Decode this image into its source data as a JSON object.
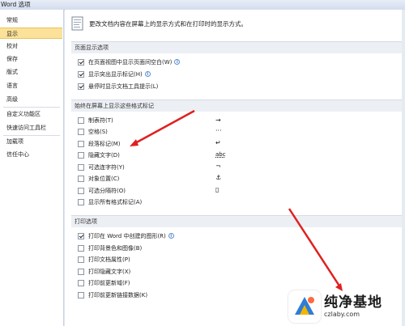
{
  "window": {
    "title": "Word 选项"
  },
  "sidebar": {
    "items": [
      {
        "label": "常规"
      },
      {
        "label": "显示",
        "active": true
      },
      {
        "label": "校对"
      },
      {
        "label": "保存"
      },
      {
        "label": "版式"
      },
      {
        "label": "语言"
      },
      {
        "label": "高级"
      },
      {
        "label": "自定义功能区"
      },
      {
        "label": "快速访问工具栏"
      },
      {
        "label": "加载项"
      },
      {
        "label": "信任中心"
      }
    ]
  },
  "header": {
    "text": "更改文档内容在屏幕上的显示方式和在打印时的显示方式。"
  },
  "page_display": {
    "title": "页面显示选项",
    "options": [
      {
        "label": "在页面视图中显示页面间空白(W)",
        "checked": true,
        "info": true
      },
      {
        "label": "显示突出显示标记(H)",
        "checked": true,
        "info": true
      },
      {
        "label": "悬停时显示文档工具提示(L)",
        "checked": true,
        "info": false
      }
    ]
  },
  "formatting_marks": {
    "title": "始终在屏幕上显示这些格式标记",
    "options": [
      {
        "label": "制表符(T)",
        "checked": false,
        "symbol": "→"
      },
      {
        "label": "空格(S)",
        "checked": false,
        "symbol": "···"
      },
      {
        "label": "段落标记(M)",
        "checked": false,
        "symbol": "↵"
      },
      {
        "label": "隐藏文字(D)",
        "checked": false,
        "symbol": "abc"
      },
      {
        "label": "可选连字符(Y)",
        "checked": false,
        "symbol": "¬"
      },
      {
        "label": "对象位置(C)",
        "checked": false,
        "symbol": "⚓"
      },
      {
        "label": "可选分隔符(O)",
        "checked": false,
        "symbol": "▯"
      },
      {
        "label": "显示所有格式标记(A)",
        "checked": false,
        "symbol": ""
      }
    ]
  },
  "print_options": {
    "title": "打印选项",
    "options": [
      {
        "label": "打印在 Word 中创建的图形(R)",
        "checked": true,
        "info": true
      },
      {
        "label": "打印背景色和图像(B)",
        "checked": false
      },
      {
        "label": "打印文档属性(P)",
        "checked": false
      },
      {
        "label": "打印隐藏文字(X)",
        "checked": false
      },
      {
        "label": "打印前更新域(F)",
        "checked": false
      },
      {
        "label": "打印前更新链接数据(K)",
        "checked": false
      }
    ]
  },
  "watermark": {
    "title": "纯净基地",
    "subtitle": "czlaby.com"
  },
  "colors": {
    "active_bg": "#fbe199",
    "arrow": "#e02020",
    "info": "#3d76c2"
  }
}
